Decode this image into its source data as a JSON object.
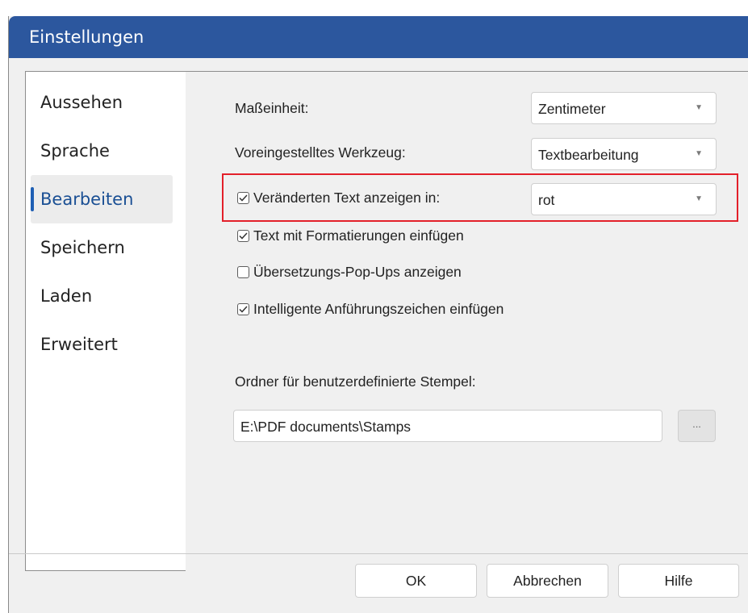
{
  "window": {
    "title": "Einstellungen"
  },
  "sidebar": {
    "items": [
      {
        "label": "Aussehen"
      },
      {
        "label": "Sprache"
      },
      {
        "label": "Bearbeiten"
      },
      {
        "label": "Speichern"
      },
      {
        "label": "Laden"
      },
      {
        "label": "Erweitert"
      }
    ],
    "selected": "Bearbeiten"
  },
  "settings": {
    "unit": {
      "label": "Maßeinheit:",
      "value": "Zentimeter"
    },
    "default_tool": {
      "label": "Voreingestelltes Werkzeug:",
      "value": "Textbearbeitung"
    },
    "changed_text": {
      "label": "Veränderten Text anzeigen in:",
      "checked": true,
      "value": "rot"
    },
    "paste_formatting": {
      "label": "Text mit Formatierungen einfügen",
      "checked": true
    },
    "translation_popups": {
      "label": "Übersetzungs-Pop-Ups anzeigen",
      "checked": false
    },
    "smart_quotes": {
      "label": "Intelligente Anführungszeichen einfügen",
      "checked": true
    },
    "stamps_folder": {
      "label": "Ordner für benutzerdefinierte Stempel:",
      "value": "E:\\PDF documents\\Stamps",
      "browse_label": "..."
    }
  },
  "footer": {
    "ok": "OK",
    "cancel": "Abbrechen",
    "help": "Hilfe"
  },
  "colors": {
    "titlebar": "#2c579e",
    "highlight": "#e3202a",
    "accent": "#1f5fb4"
  }
}
